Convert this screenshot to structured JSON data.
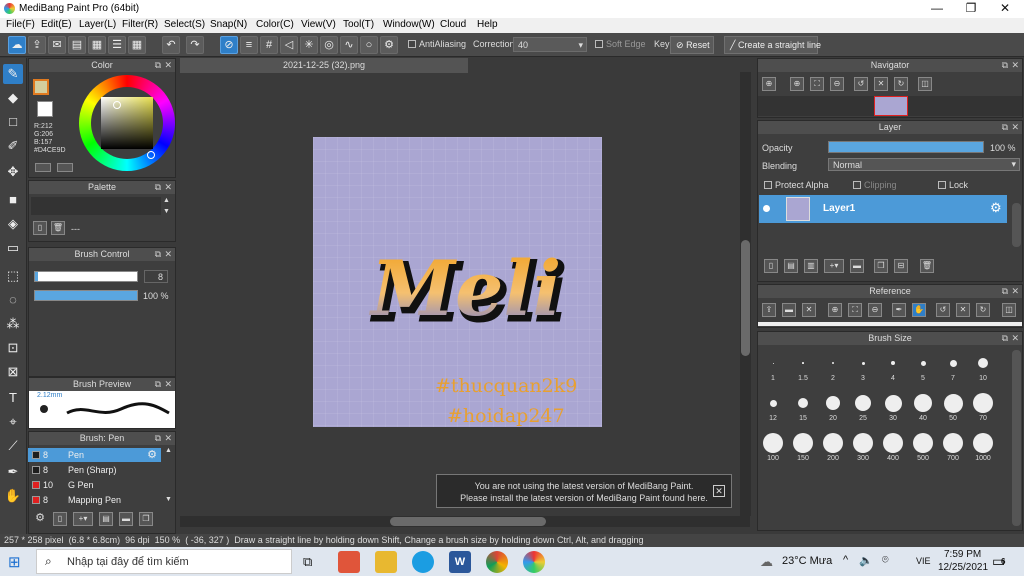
{
  "window": {
    "title": "MediBang Paint Pro (64bit)",
    "minimize": "—",
    "maximize": "❐",
    "close": "✕"
  },
  "menu": [
    "File(F)",
    "Edit(E)",
    "Layer(L)",
    "Filter(R)",
    "Select(S)",
    "Snap(N)",
    "Color(C)",
    "View(V)",
    "Tool(T)",
    "Window(W)",
    "Cloud",
    "Help"
  ],
  "toolbar": {
    "antialiasing": "AntiAliasing",
    "correction_label": "Correction",
    "correction_value": "40",
    "soft_edge": "Soft Edge",
    "key": "Key",
    "reset": "Reset",
    "straight_line": "Create a straight line"
  },
  "color_panel": {
    "title": "Color",
    "primary_color": "#D4CE9D",
    "rgb_r": "R:212",
    "rgb_g": "G:206",
    "rgb_b": "B:157",
    "hex": "#D4CE9D"
  },
  "palette_panel": {
    "title": "Palette",
    "placeholder": "---"
  },
  "brush_control": {
    "title": "Brush Control",
    "size": "8",
    "opacity": "100 %",
    "size_fraction": 0.03,
    "opacity_fraction": 1.0
  },
  "brush_preview": {
    "title": "Brush Preview",
    "size_label": "2.12mm"
  },
  "brush_list": {
    "title": "Brush: Pen",
    "items": [
      {
        "size": "8",
        "name": "Pen",
        "color": "#1e1e1e"
      },
      {
        "size": "8",
        "name": "Pen (Sharp)",
        "color": "#1e1e1e"
      },
      {
        "size": "10",
        "name": "G Pen",
        "color": "#e02020"
      },
      {
        "size": "8",
        "name": "Mapping Pen",
        "color": "#e02020"
      }
    ]
  },
  "document": {
    "tab": "2021-12-25 (32).png",
    "canvas_color": "#AAA6D2",
    "artwork_text": "Meli",
    "watermark_1": "#thucquan2k9",
    "watermark_2": "#hoidap247"
  },
  "notice": {
    "line1": "You are not using the latest version of MediBang Paint.",
    "line2": "Please install the latest version of MediBang Paint found here."
  },
  "navigator": {
    "title": "Navigator"
  },
  "layer_panel": {
    "title": "Layer",
    "opacity_label": "Opacity",
    "opacity_value": "100 %",
    "opacity_fraction": 1.0,
    "blending_label": "Blending",
    "blending_value": "Normal",
    "protect_alpha": "Protect Alpha",
    "clipping": "Clipping",
    "lock": "Lock",
    "layer_name": "Layer1"
  },
  "reference": {
    "title": "Reference"
  },
  "brush_size": {
    "title": "Brush Size",
    "sizes": [
      "1",
      "1.5",
      "2",
      "3",
      "4",
      "5",
      "7",
      "10",
      "12",
      "15",
      "20",
      "25",
      "30",
      "40",
      "50",
      "70",
      "100",
      "150",
      "200",
      "300",
      "400",
      "500",
      "700",
      "1000"
    ]
  },
  "status": {
    "dimensions": "257 * 258 pixel",
    "physical": "(6.8 * 6.8cm)",
    "dpi": "96 dpi",
    "zoom": "150 %",
    "coords": "( -36, 327 )",
    "hint": "Draw a straight line by holding down Shift, Change a brush size by holding down Ctrl, Alt, and dragging"
  },
  "taskbar": {
    "search_placeholder": "Nhập tại đây để tìm kiếm",
    "weather": "23°C  Mưa",
    "lang": "VIE",
    "time": "7:59 PM",
    "date": "12/25/2021",
    "notifications": "6"
  }
}
